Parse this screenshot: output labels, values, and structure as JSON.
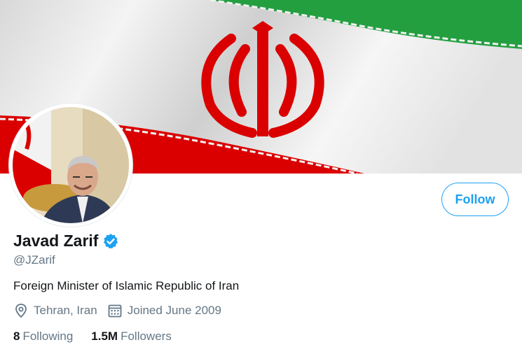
{
  "profile": {
    "display_name": "Javad Zarif",
    "handle": "@JZarif",
    "bio": "Foreign Minister of Islamic Republic of Iran",
    "location": "Tehran, Iran",
    "joined": "Joined June 2009",
    "verified": true
  },
  "actions": {
    "follow_label": "Follow"
  },
  "stats": {
    "following_count": "8",
    "following_label": "Following",
    "followers_count": "1.5M",
    "followers_label": "Followers"
  },
  "colors": {
    "accent": "#1da1f2",
    "flag_green": "#239f40",
    "flag_red": "#da0000",
    "secondary_text": "#657786"
  },
  "icons": {
    "verified": "verified-badge-icon",
    "location": "location-pin-icon",
    "joined": "calendar-icon"
  }
}
